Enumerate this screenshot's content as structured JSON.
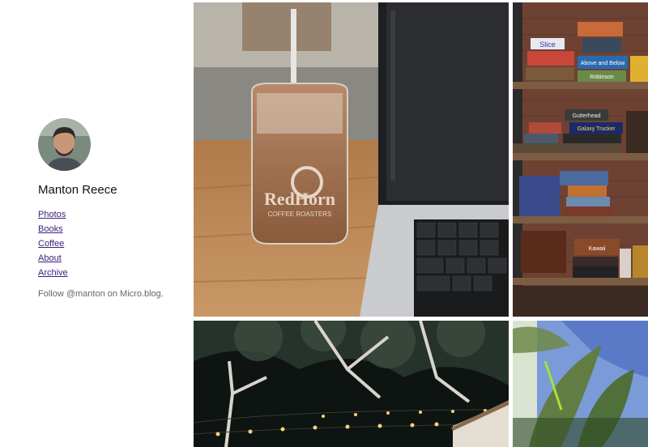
{
  "profile": {
    "name": "Manton Reece",
    "avatar_icon": "profile-photo"
  },
  "nav": {
    "items": [
      {
        "label": "Photos"
      },
      {
        "label": "Books"
      },
      {
        "label": "Coffee"
      },
      {
        "label": "About"
      },
      {
        "label": "Archive"
      }
    ]
  },
  "follow_text": "Follow @manton on Micro.blog.",
  "photos": [
    {
      "subject": "iced-coffee-laptop",
      "cup_logo_text": "RedHorn",
      "cup_logo_sub": "COFFEE ROASTERS"
    },
    {
      "subject": "board-game-shelves",
      "box_titles": [
        "Slice",
        "Above and Below",
        "Robinson",
        "Gutterhead",
        "Galaxy Trucker",
        "Kawaii"
      ]
    },
    {
      "subject": "string-lights-tree-night"
    },
    {
      "subject": "plant-leaves-blue-wall"
    }
  ],
  "colors": {
    "link": "#3a1f7a",
    "text": "#111111",
    "muted": "#666666"
  }
}
